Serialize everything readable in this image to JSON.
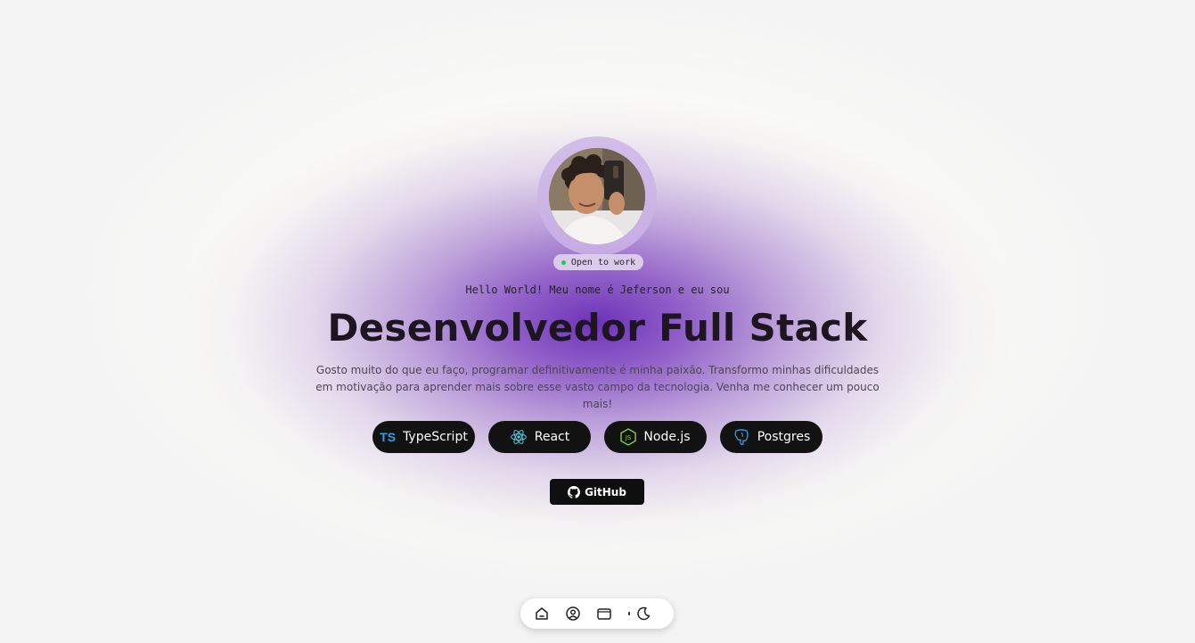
{
  "hero": {
    "status": "Open to work",
    "greeting": "Hello World! Meu nome é Jeferson e eu sou",
    "title": "Desenvolvedor Full Stack",
    "description": "Gosto muito do que eu faço, programar definitivamente é minha paixão. Transformo minhas dificuldades em motivação para aprender mais sobre esse vasto campo da tecnologia. Venha me conhecer um pouco mais!"
  },
  "techs": [
    {
      "label": "TypeScript",
      "icon": "typescript-icon",
      "icon_text": "TS",
      "color": "#2f9ee6"
    },
    {
      "label": "React",
      "icon": "react-icon",
      "color": "#58c4dc"
    },
    {
      "label": "Node.js",
      "icon": "nodejs-icon",
      "color": "#8cc84b"
    },
    {
      "label": "Postgres",
      "icon": "postgres-icon",
      "color": "#336791"
    }
  ],
  "github": {
    "label": "GitHub",
    "icon": "github-icon"
  },
  "dock": {
    "items": [
      {
        "icon": "home-icon"
      },
      {
        "icon": "user-icon"
      },
      {
        "icon": "folder-icon"
      },
      {
        "icon": "moon-icon"
      }
    ]
  },
  "colors": {
    "accent": "#6628b4",
    "button_bg": "#121212",
    "status_dot": "#22c55e"
  }
}
